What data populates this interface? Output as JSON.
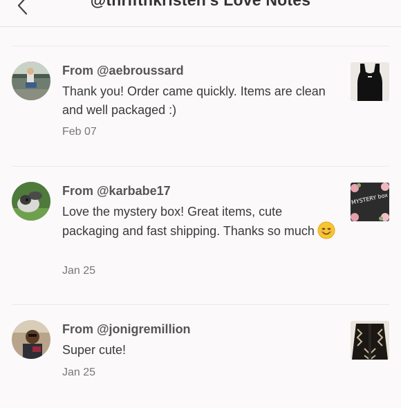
{
  "header": {
    "title": "@thriftnkristen's Love Notes",
    "back_icon": "chevron-left-icon"
  },
  "notes": [
    {
      "from": "From @aebroussard",
      "message": "Thank you! Order came quickly. Items are clean and well packaged :)",
      "date": "Feb 07",
      "thumb_desc": "black tank top"
    },
    {
      "from": "From @karbabe17",
      "message": "Love the mystery box! Great items, cute packaging and fast shipping. Thanks so much",
      "emoji": "smiling-face-emoji",
      "date": "Jan 25",
      "thumb_text": "MYSTERY box"
    },
    {
      "from": "From @jonigremillion",
      "message": "Super cute!",
      "date": "Jan 25",
      "thumb_desc": "patterned cardigan"
    }
  ],
  "colors": {
    "background": "#fbf9fa",
    "divider": "#ece9ea",
    "title": "#333333",
    "sender": "#555555"
  }
}
